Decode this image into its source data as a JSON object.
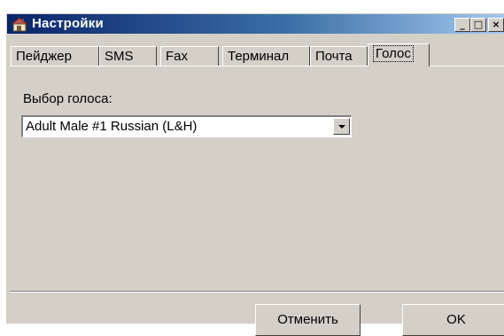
{
  "window": {
    "title": "Настройки",
    "minimize_label": "_",
    "maximize_label": "□",
    "close_label": "×"
  },
  "tabs": [
    {
      "label": "Пейджер"
    },
    {
      "label": "SMS"
    },
    {
      "label": "Fax"
    },
    {
      "label": "Терминал"
    },
    {
      "label": "Почта"
    },
    {
      "label": "Голос",
      "active": true
    }
  ],
  "voice": {
    "label": "Выбор голоса:",
    "selected": "Adult Male #1 Russian (L&H)"
  },
  "buttons": {
    "cancel": "Отменить",
    "ok": "OK"
  }
}
